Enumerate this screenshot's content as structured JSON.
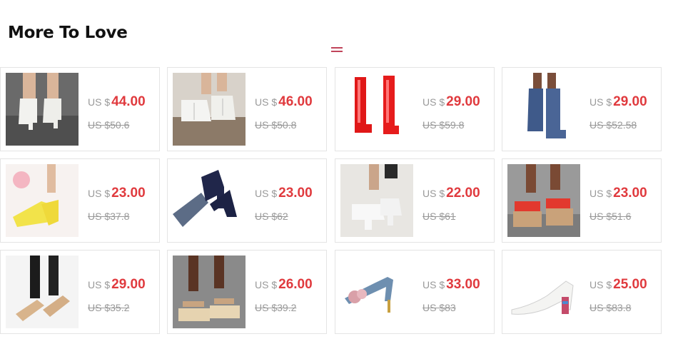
{
  "section": {
    "title": "More To Love"
  },
  "products": [
    {
      "currency": "US $",
      "price": "44.00",
      "original_price": "US $50.6",
      "image": "white-ankle-boots"
    },
    {
      "currency": "US $",
      "price": "46.00",
      "original_price": "US $50.8",
      "image": "white-lace-up-ankle-boots"
    },
    {
      "currency": "US $",
      "price": "29.00",
      "original_price": "US $59.8",
      "image": "red-patent-knee-boots"
    },
    {
      "currency": "US $",
      "price": "29.00",
      "original_price": "US $52.58",
      "image": "blue-knee-high-boots"
    },
    {
      "currency": "US $",
      "price": "23.00",
      "original_price": "US $37.8",
      "image": "yellow-mary-jane-heels"
    },
    {
      "currency": "US $",
      "price": "23.00",
      "original_price": "US $62",
      "image": "navy-platform-heels"
    },
    {
      "currency": "US $",
      "price": "22.00",
      "original_price": "US $61",
      "image": "white-platform-mary-janes"
    },
    {
      "currency": "US $",
      "price": "23.00",
      "original_price": "US $51.6",
      "image": "red-wedge-sandals"
    },
    {
      "currency": "US $",
      "price": "29.00",
      "original_price": "US $35.2",
      "image": "beige-flat-sandals"
    },
    {
      "currency": "US $",
      "price": "26.00",
      "original_price": "US $39.2",
      "image": "beige-platform-sandals"
    },
    {
      "currency": "US $",
      "price": "33.00",
      "original_price": "US $83",
      "image": "denim-flower-sandals"
    },
    {
      "currency": "US $",
      "price": "25.00",
      "original_price": "US $83.8",
      "image": "white-block-heel-sandals"
    }
  ],
  "colors": {
    "price": "#e03a3e",
    "muted": "#999999",
    "border": "#e4e4e4",
    "accent": "#c0445a"
  }
}
